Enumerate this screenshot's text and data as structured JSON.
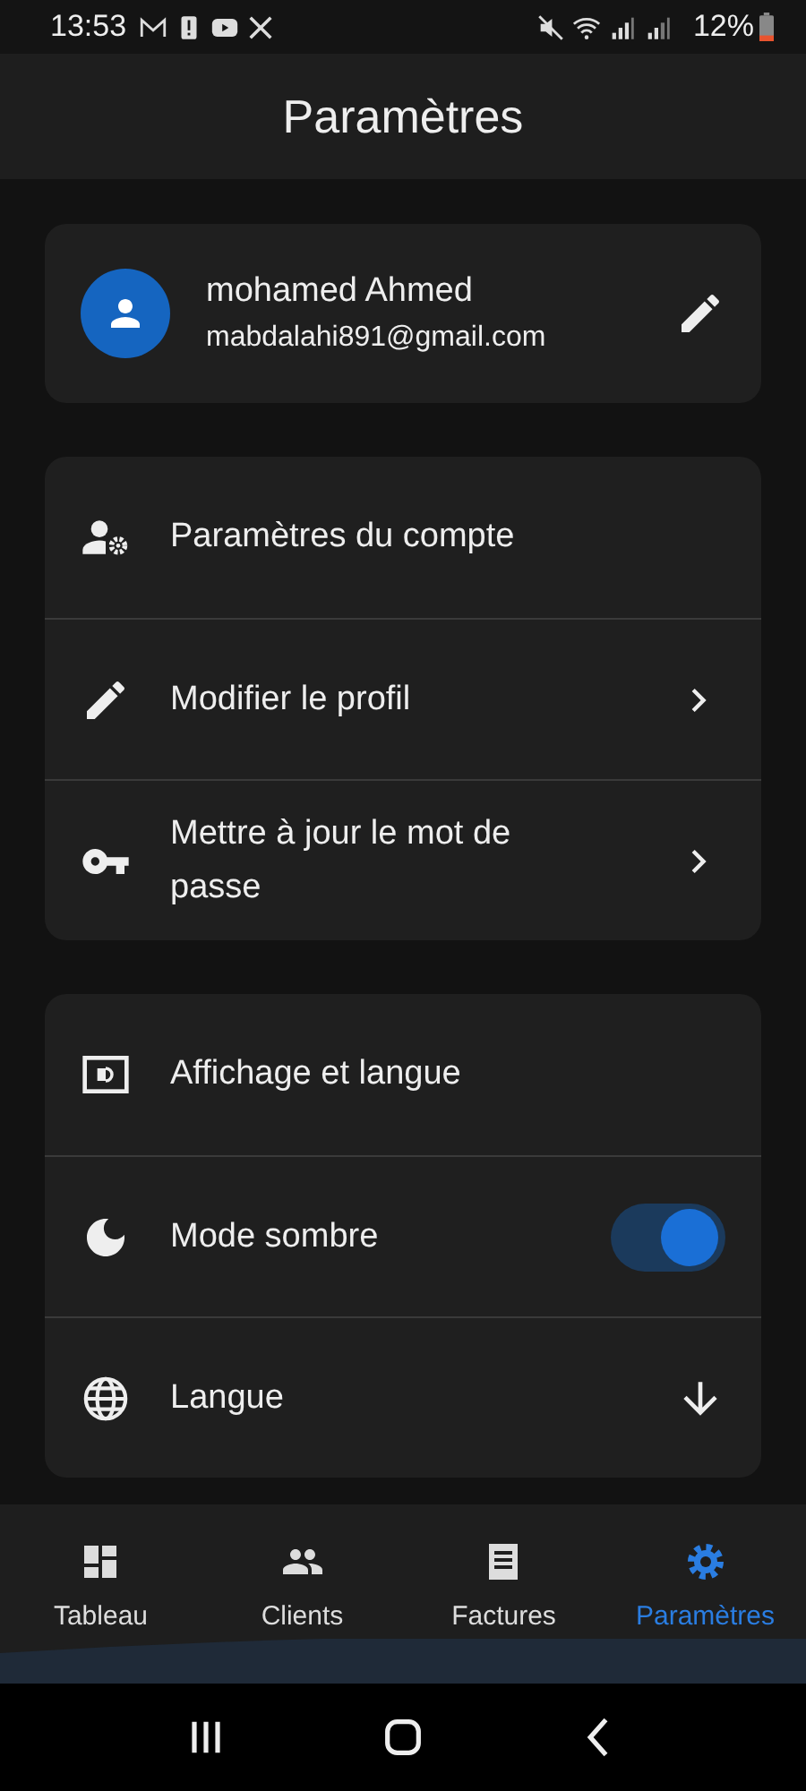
{
  "status_bar": {
    "time": "13:53",
    "battery": "12%"
  },
  "app_bar": {
    "title": "Paramètres"
  },
  "profile": {
    "name": "mohamed Ahmed",
    "email": "mabdalahi891@gmail.com"
  },
  "sections": [
    {
      "items": [
        {
          "kind": "header",
          "label": "Paramètres du compte"
        },
        {
          "kind": "link",
          "label": "Modifier le profil"
        },
        {
          "kind": "link",
          "label": "Mettre à jour le mot de passe"
        }
      ]
    },
    {
      "items": [
        {
          "kind": "header",
          "label": "Affichage et langue"
        },
        {
          "kind": "toggle",
          "label": "Mode sombre",
          "on": true
        },
        {
          "kind": "dropdown",
          "label": "Langue"
        }
      ]
    }
  ],
  "bottom_nav": [
    {
      "label": "Tableau",
      "selected": false
    },
    {
      "label": "Clients",
      "selected": false
    },
    {
      "label": "Factures",
      "selected": false
    },
    {
      "label": "Paramètres",
      "selected": true
    }
  ]
}
